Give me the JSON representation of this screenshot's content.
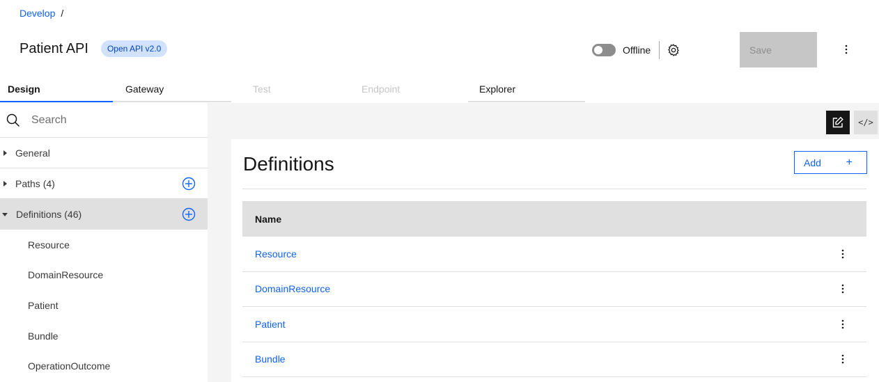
{
  "breadcrumb": {
    "items": [
      {
        "label": "Develop"
      }
    ],
    "separator": "/"
  },
  "header": {
    "title": "Patient API",
    "badge": "Open API v2.0",
    "toggle_label": "Offline",
    "toggle_state": "off",
    "save_label": "Save",
    "icons": {
      "settings": "gear-icon",
      "overflow": "overflow-menu-vertical-icon"
    }
  },
  "tabs": [
    {
      "label": "Design",
      "state": "active"
    },
    {
      "label": "Gateway",
      "state": "enabled"
    },
    {
      "label": "Test",
      "state": "disabled"
    },
    {
      "label": "Endpoint",
      "state": "disabled"
    },
    {
      "label": "Explorer",
      "state": "enabled"
    }
  ],
  "sidebar": {
    "search_placeholder": "Search",
    "sections": [
      {
        "label": "General",
        "expanded": false,
        "has_add": false
      },
      {
        "label": "Paths (4)",
        "expanded": false,
        "has_add": true
      },
      {
        "label": "Definitions (46)",
        "expanded": true,
        "has_add": true,
        "selected": true
      }
    ],
    "definitions_children": [
      "Resource",
      "DomainResource",
      "Patient",
      "Bundle",
      "OperationOutcome"
    ]
  },
  "view_toggle": {
    "options": [
      {
        "icon": "edit-icon",
        "state": "active"
      },
      {
        "icon": "code-icon",
        "label": "</>",
        "state": "inactive"
      }
    ]
  },
  "main": {
    "title": "Definitions",
    "add_label": "Add",
    "add_icon": "+",
    "table": {
      "headers": [
        "Name"
      ],
      "rows": [
        {
          "name": "Resource"
        },
        {
          "name": "DomainResource"
        },
        {
          "name": "Patient"
        },
        {
          "name": "Bundle"
        }
      ]
    }
  },
  "colors": {
    "accent": "#0f62fe",
    "badge_bg": "#d0e2ff",
    "badge_text": "#0043ce",
    "disabled_bg": "#c6c6c6",
    "selected_bg": "#e0e0e0"
  }
}
